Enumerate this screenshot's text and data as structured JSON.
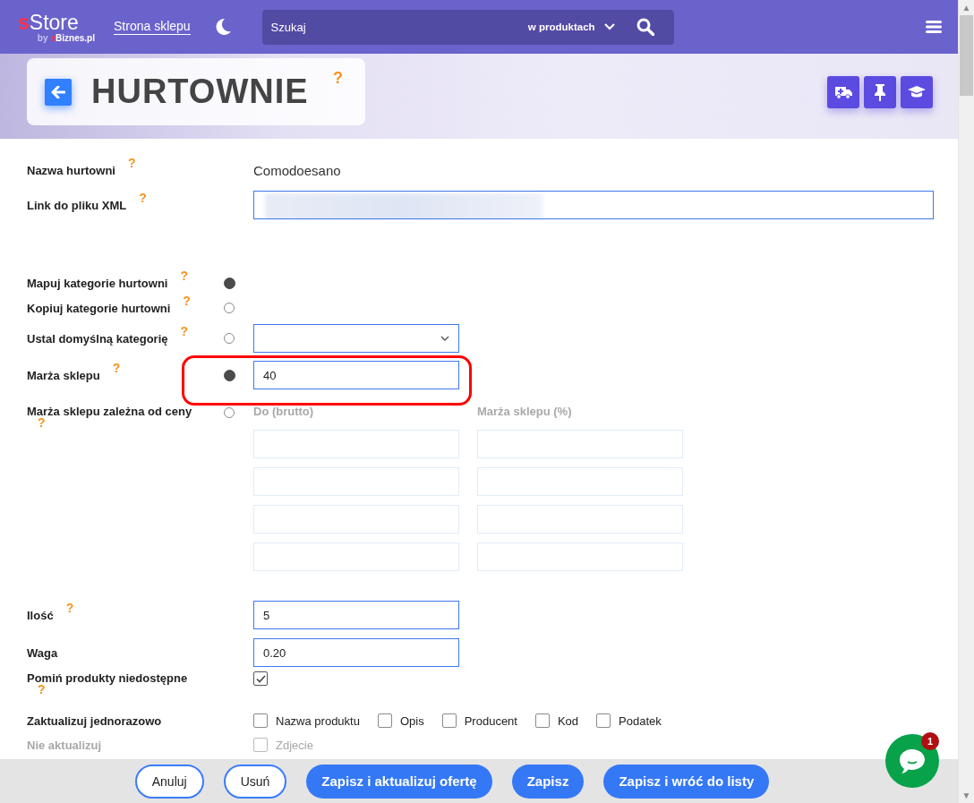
{
  "header": {
    "logo": {
      "accent": "s",
      "text": "Store"
    },
    "byline": {
      "prefix": "by",
      "accent": "e",
      "text": "Biznes.pl"
    },
    "nav_link": "Strona sklepu",
    "search": {
      "placeholder": "Szukaj",
      "scope": "w produktach"
    }
  },
  "scrollbar": {
    "up": "▲",
    "down": "▼"
  },
  "page": {
    "title": "HURTOWNIE",
    "help": "?",
    "tools": [
      {
        "kind": "ambulance"
      },
      {
        "kind": "pin"
      },
      {
        "kind": "graduation"
      }
    ]
  },
  "fields": [
    {
      "kind": "static",
      "label": "Nazwa hurtowni",
      "help": {
        "kind": "inline",
        "text": "?"
      },
      "value": "Comodoesano"
    },
    {
      "kind": "redacted_input",
      "label": "Link do pliku XML",
      "help": {
        "kind": "inline",
        "text": "?"
      }
    },
    {
      "kind": "radio",
      "label": "Mapuj kategorie hurtowni",
      "help": {
        "kind": "inline",
        "text": "?"
      },
      "selected": true
    },
    {
      "kind": "radio",
      "label": "Kopiuj kategorie hurtowni",
      "help": {
        "kind": "inline",
        "text": "?"
      },
      "selected": false
    },
    {
      "kind": "radio_select",
      "label": "Ustal domyślną kategorię",
      "help": {
        "kind": "inline",
        "text": "?"
      },
      "selected": false
    },
    {
      "kind": "radio_input",
      "label": "Marża sklepu",
      "help": {
        "kind": "inline",
        "text": "?"
      },
      "selected": true,
      "value": "40",
      "highlighted": true
    },
    {
      "kind": "radio_table",
      "label": "Marża sklepu zależna od ceny",
      "help": {
        "kind": "below",
        "text": "?"
      },
      "selected": false,
      "disabled": true,
      "columns": [
        "Do (brutto)",
        "Marża sklepu (%)"
      ],
      "rows": [
        {
          "kind": "blank"
        },
        {
          "kind": "blank"
        },
        {
          "kind": "blank"
        },
        {
          "kind": "blank"
        }
      ]
    },
    {
      "kind": "input",
      "label": "Ilość",
      "help": {
        "kind": "inline",
        "text": "?"
      },
      "value": "5"
    },
    {
      "kind": "input",
      "label": "Waga",
      "value": "0.20"
    },
    {
      "kind": "checkbox",
      "label": "Pomiń produkty niedostępne",
      "help": {
        "kind": "below",
        "text": "?"
      },
      "checked": true
    },
    {
      "kind": "checkbox_group",
      "label": "Zaktualizuj jednorazowo",
      "options": [
        {
          "label": "Nazwa produktu",
          "checked": false
        },
        {
          "label": "Opis",
          "checked": false
        },
        {
          "label": "Producent",
          "checked": false
        },
        {
          "label": "Kod",
          "checked": false
        },
        {
          "label": "Podatek",
          "checked": false
        }
      ]
    },
    {
      "kind": "checkbox_group",
      "label": "Nie aktualizuj",
      "faded": true,
      "options": [
        {
          "label": "Zdjecie",
          "checked": false
        }
      ]
    }
  ],
  "footer": {
    "buttons": [
      {
        "label": "Anuluj",
        "kind": "outline"
      },
      {
        "label": "Usuń",
        "kind": "outline"
      },
      {
        "label": "Zapisz i aktualizuj ofertę",
        "kind": "primary"
      },
      {
        "label": "Zapisz",
        "kind": "primary"
      },
      {
        "label": "Zapisz i wróć do listy",
        "kind": "primary"
      }
    ]
  },
  "chat": {
    "badge": "1"
  }
}
